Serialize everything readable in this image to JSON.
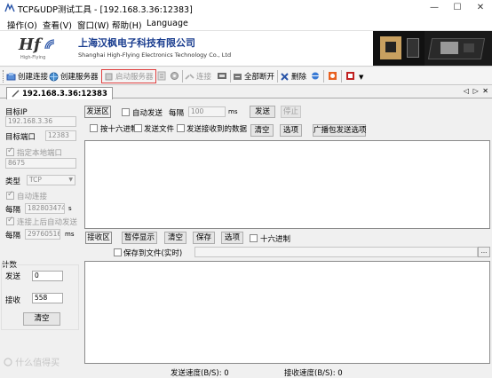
{
  "window": {
    "title": "TCP&UDP测试工具 - [192.168.3.36:12383]",
    "minimize": "—",
    "maximize": "☐",
    "close": "✕"
  },
  "menu": [
    "操作(O)",
    "查看(V)",
    "窗口(W)",
    "帮助(H)",
    "Language"
  ],
  "banner": {
    "logo_text": "Hf",
    "logo_sub": "High-Flying",
    "company_cn": "上海汉枫电子科技有限公司",
    "company_en": "Shanghai High-Flying Electronics Technology Co., Ltd"
  },
  "toolbar": {
    "create_connection": "创建连接",
    "create_server": "创建服务器",
    "start_server": "启动服务器",
    "connect": "连接",
    "disconnect_all": "全部断开",
    "delete": "删除"
  },
  "tab": {
    "label": "192.168.3.36:12383",
    "nav": "◁ ▷ ✕"
  },
  "left_panel": {
    "target_ip_label": "目标IP",
    "target_ip": "192.168.3.36",
    "target_port_label": "目标端口",
    "target_port": "12383",
    "specify_local_port": "指定本地端口",
    "local_port": "8675",
    "type_label": "类型",
    "type_value": "TCP",
    "auto_connect": "自动连接",
    "interval1_label": "每隔",
    "interval1_value": "182803474",
    "interval1_unit": "s",
    "auto_send_after_connect": "连接上后自动发送",
    "interval2_label": "每隔",
    "interval2_value": "29760516",
    "interval2_unit": "ms",
    "count_label": "计数",
    "send_label": "发送",
    "send_value": "0",
    "recv_label": "接收",
    "recv_value": "558",
    "clear_button": "清空"
  },
  "send_area": {
    "title": "发送区",
    "auto_send": "自动发送",
    "interval_label": "每隔",
    "interval_value": "100",
    "interval_unit": "ms",
    "send_button": "发送",
    "stop_button": "停止",
    "hex_send": "按十六进制",
    "send_file": "发送文件",
    "send_received": "发送接收到的数据",
    "clear_button": "清空",
    "options_button": "选项",
    "broadcast_button": "广播包发送选项"
  },
  "recv_area": {
    "title": "接收区",
    "pause_button": "暂停显示",
    "clear_button": "清空",
    "save_button": "保存",
    "options_button": "选项",
    "hex_display": "十六进制",
    "save_to_file": "保存到文件(实时)",
    "browse_button": "..."
  },
  "status": {
    "send_speed": "发送速度(B/S): 0",
    "recv_speed": "接收速度(B/S): 0"
  },
  "watermark": "什么值得买"
}
